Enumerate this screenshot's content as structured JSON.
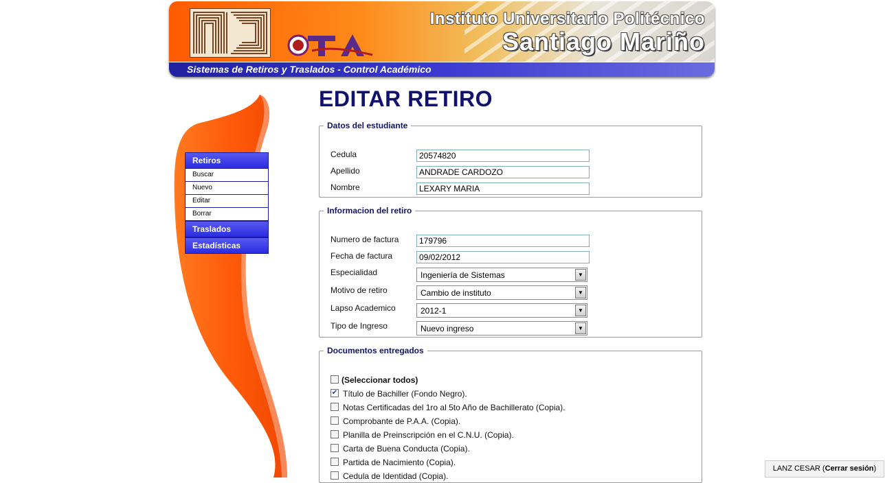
{
  "banner": {
    "institute_line1": "Instituto Universitario Politécnico",
    "institute_line2": "Santiago Mariño",
    "subtitle": "Sistemas de Retiros y Traslados - Control Académico",
    "logo_text": "OTA"
  },
  "menu": {
    "retiros": "Retiros",
    "buscar": "Buscar",
    "nuevo": "Nuevo",
    "editar": "Editar",
    "borrar": "Borrar",
    "traslados": "Traslados",
    "estadisticas": "Estadísticas"
  },
  "page_title": "EDITAR RETIRO",
  "student": {
    "legend": "Datos del estudiante",
    "cedula_label": "Cedula",
    "cedula_value": "20574820",
    "apellido_label": "Apellido",
    "apellido_value": "ANDRADE CARDOZO",
    "nombre_label": "Nombre",
    "nombre_value": "LEXARY MARIA"
  },
  "retiro": {
    "legend": "Informacion del retiro",
    "factura_label": "Numero de factura",
    "factura_value": "179796",
    "fecha_label": "Fecha de factura",
    "fecha_value": "09/02/2012",
    "especialidad_label": "Especialidad",
    "especialidad_value": "Ingeniería de Sistemas",
    "motivo_label": "Motivo de retiro",
    "motivo_value": "Cambio de instituto",
    "lapso_label": "Lapso Academico",
    "lapso_value": "2012-1",
    "tipo_label": "Tipo de Ingreso",
    "tipo_value": "Nuevo ingreso"
  },
  "documents": {
    "legend": "Documentos entregados",
    "select_all": "(Seleccionar todos)",
    "items": [
      {
        "label": "Título de Bachiller (Fondo Negro).",
        "checked": true
      },
      {
        "label": "Notas Certificadas del 1ro al 5to Año de Bachillerato (Copia).",
        "checked": false
      },
      {
        "label": "Comprobante de P.A.A. (Copia).",
        "checked": false
      },
      {
        "label": "Planilla de Preinscripción en el C.N.U. (Copia).",
        "checked": false
      },
      {
        "label": "Carta de Buena Conducta (Copia).",
        "checked": false
      },
      {
        "label": "Partida de Nacimiento (Copia).",
        "checked": false
      },
      {
        "label": "Cedula de Identidad (Copia).",
        "checked": false
      }
    ]
  },
  "session": {
    "user": "LANZ CESAR (",
    "logout": "Cerrar sesión",
    "close_paren": ")"
  }
}
